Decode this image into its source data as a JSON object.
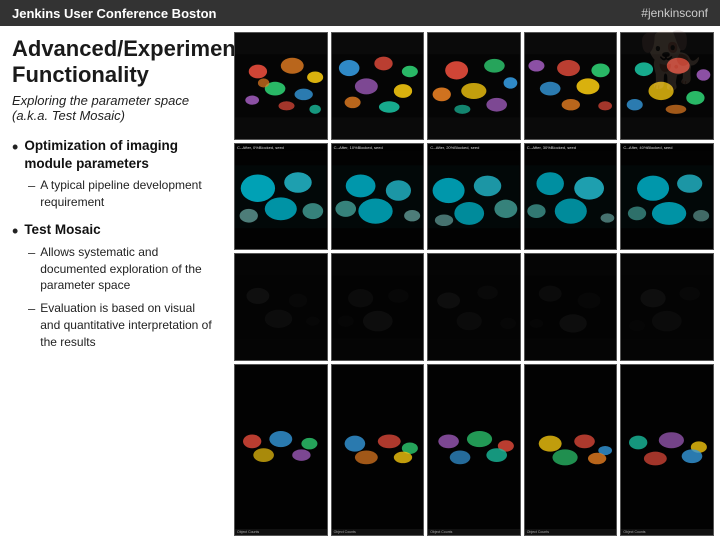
{
  "header": {
    "title": "Jenkins User Conference Boston",
    "hashtag": "#jenkinsconf"
  },
  "slide": {
    "title": "Advanced/Experimental Functionality",
    "subtitle": "Exploring the parameter space (a.k.a. Test Mosaic)",
    "bullets": [
      {
        "id": "bullet1",
        "text": "Optimization of imaging module parameters",
        "sub_bullets": [
          {
            "id": "sub1a",
            "text": "A typical pipeline development requirement"
          }
        ]
      },
      {
        "id": "bullet2",
        "text": "Test Mosaic",
        "sub_bullets": [
          {
            "id": "sub2a",
            "text": "Allows systematic and documented exploration of the parameter space"
          },
          {
            "id": "sub2b",
            "text": "Evaluation is based on visual and quantitative interpretation of the results"
          }
        ]
      }
    ]
  }
}
